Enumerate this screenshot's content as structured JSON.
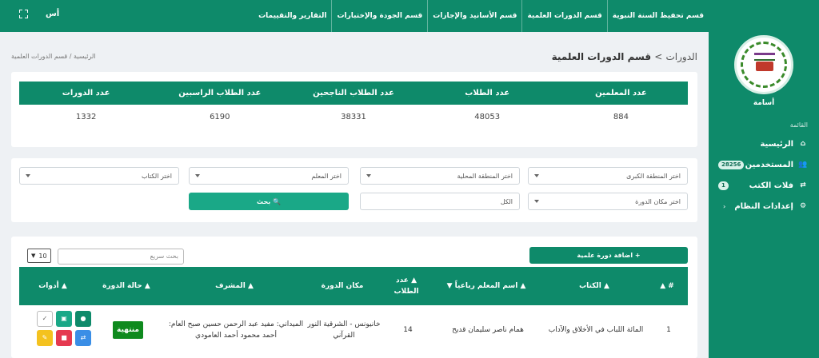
{
  "app": {
    "user_name": "أسامة",
    "top_user": "أس"
  },
  "top_nav": [
    {
      "label": "قسم تحفيظ السنة النبوية"
    },
    {
      "label": "قسم الدورات العلمية"
    },
    {
      "label": "قسم الأسانيد والإجازات"
    },
    {
      "label": "قسم الجودة والإختبارات"
    },
    {
      "label": "التقارير والتقييمات"
    }
  ],
  "sidebar": {
    "caption": "القائمة",
    "items": [
      {
        "label": "الرئيسية",
        "icon": "home-icon"
      },
      {
        "label": "المستخدمين",
        "icon": "users-icon",
        "badge": "28256"
      },
      {
        "label": "فلات الكتب",
        "icon": "share-icon",
        "badge": "1"
      },
      {
        "label": "إعدادات النظام",
        "icon": "gear-icon"
      }
    ]
  },
  "header": {
    "crumb_parent": "الدورات",
    "separator": ">",
    "title": "قسم الدورات العلمية",
    "breadcrumb": "الرئيسية / قسم الدورات العلمية"
  },
  "stats": {
    "headers": [
      "عدد المعلمين",
      "عدد الطلاب",
      "عدد الطلاب الناجحين",
      "عدد الطلاب الراسبين",
      "عدد الدورات"
    ],
    "values": [
      "884",
      "48053",
      "38331",
      "6190",
      "1332"
    ]
  },
  "filters": {
    "region_major": "اختر المنطقة الكبرى",
    "region_local": "اختر المنطقة المحلية",
    "teacher": "اختر المعلم",
    "book": "اختر الكتاب",
    "place": "اختر مكان الدورة",
    "all": "الكل",
    "search_button": "🔍 بحث"
  },
  "list": {
    "add_button": "+ اضافة دورة علمية",
    "search_placeholder": "بحث سريع",
    "page_size": "10",
    "columns": [
      "# ▲",
      "▲ الكتاب",
      "▲ اسم المعلم رباعياً ▼",
      "▲ عدد الطلاب",
      "مكان الدورة",
      "▲ المشرف",
      "▲ حالة الدورة",
      "▲ أدوات"
    ],
    "rows": [
      {
        "num": "1",
        "book": "المائة اللباب في الأخلاق والآداب",
        "teacher": "همام ناصر سليمان قديح",
        "students": "14",
        "place": "خانيونس - الشرقية النور القرآني",
        "supervisor": "الميداني: مفيد عبد الرحمن حسين صبح العام: أحمد محمود أحمد العامودي",
        "status": "منتهية"
      }
    ]
  },
  "colors": {
    "primary": "#0e8a6a",
    "accent": "#1aa887",
    "status_done": "#0f8a1e"
  }
}
